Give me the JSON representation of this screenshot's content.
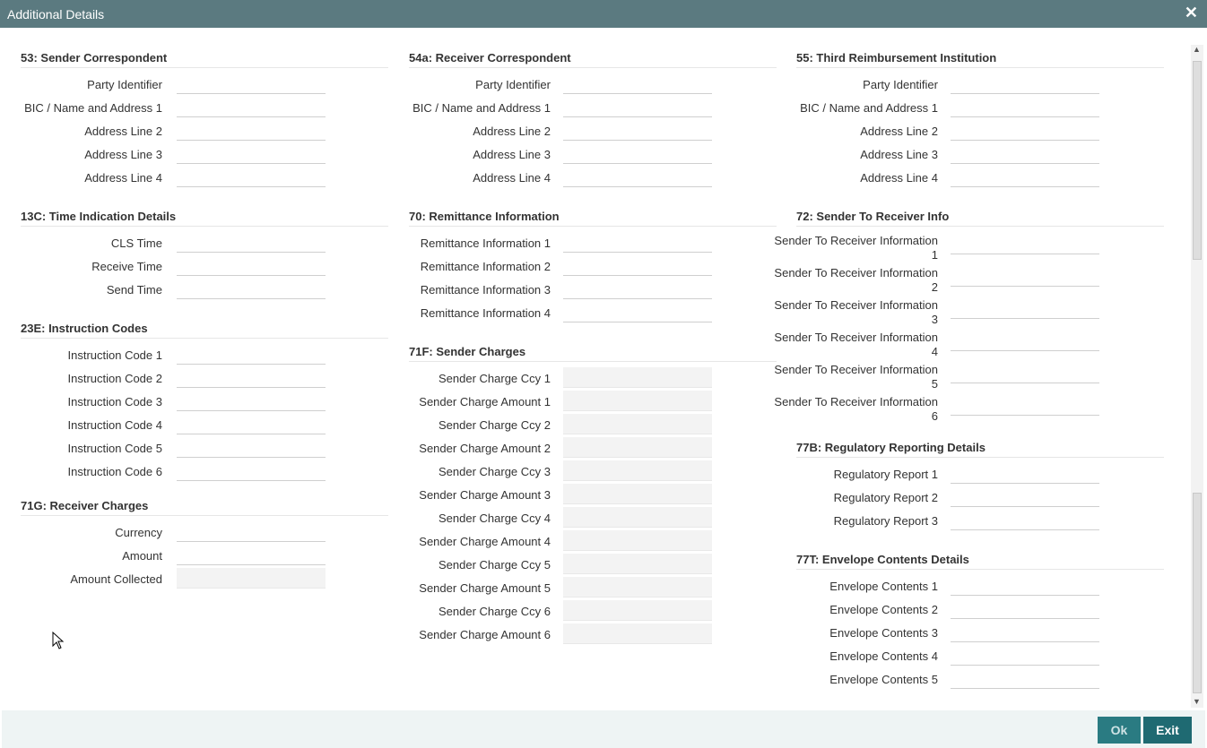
{
  "window": {
    "title": "Additional Details",
    "close_label": "✕"
  },
  "columns": [
    {
      "sections": [
        {
          "title": "53: Sender Correspondent",
          "fields": [
            {
              "label": "Party Identifier",
              "value": ""
            },
            {
              "label": "BIC / Name and Address 1",
              "value": ""
            },
            {
              "label": "Address Line 2",
              "value": ""
            },
            {
              "label": "Address Line 3",
              "value": ""
            },
            {
              "label": "Address Line 4",
              "value": ""
            }
          ]
        },
        {
          "title": "13C: Time Indication Details",
          "fields": [
            {
              "label": "CLS Time",
              "value": ""
            },
            {
              "label": "Receive Time",
              "value": ""
            },
            {
              "label": "Send Time",
              "value": ""
            }
          ]
        },
        {
          "title": "23E: Instruction Codes",
          "fields": [
            {
              "label": "Instruction Code 1",
              "value": ""
            },
            {
              "label": "Instruction Code 2",
              "value": ""
            },
            {
              "label": "Instruction Code 3",
              "value": ""
            },
            {
              "label": "Instruction Code 4",
              "value": ""
            },
            {
              "label": "Instruction Code 5",
              "value": ""
            },
            {
              "label": "Instruction Code 6",
              "value": ""
            }
          ]
        },
        {
          "title": "71G: Receiver Charges",
          "fields": [
            {
              "label": "Currency",
              "value": ""
            },
            {
              "label": "Amount",
              "value": ""
            },
            {
              "label": "Amount Collected",
              "value": "",
              "readonly": true
            }
          ]
        }
      ]
    },
    {
      "sections": [
        {
          "title": "54a: Receiver Correspondent",
          "fields": [
            {
              "label": "Party Identifier",
              "value": ""
            },
            {
              "label": "BIC / Name and Address 1",
              "value": ""
            },
            {
              "label": "Address Line 2",
              "value": ""
            },
            {
              "label": "Address Line 3",
              "value": ""
            },
            {
              "label": "Address Line 4",
              "value": ""
            }
          ]
        },
        {
          "title": "70: Remittance Information",
          "fields": [
            {
              "label": "Remittance Information 1",
              "value": ""
            },
            {
              "label": "Remittance Information 2",
              "value": ""
            },
            {
              "label": "Remittance Information 3",
              "value": ""
            },
            {
              "label": "Remittance Information 4",
              "value": ""
            }
          ]
        },
        {
          "title": "71F: Sender Charges",
          "fields": [
            {
              "label": "Sender Charge Ccy 1",
              "value": "",
              "readonly": true
            },
            {
              "label": "Sender Charge Amount 1",
              "value": "",
              "readonly": true
            },
            {
              "label": "Sender Charge Ccy 2",
              "value": "",
              "readonly": true
            },
            {
              "label": "Sender Charge Amount 2",
              "value": "",
              "readonly": true
            },
            {
              "label": "Sender Charge Ccy 3",
              "value": "",
              "readonly": true
            },
            {
              "label": "Sender Charge Amount 3",
              "value": "",
              "readonly": true
            },
            {
              "label": "Sender Charge Ccy 4",
              "value": "",
              "readonly": true
            },
            {
              "label": "Sender Charge Amount 4",
              "value": "",
              "readonly": true
            },
            {
              "label": "Sender Charge Ccy 5",
              "value": "",
              "readonly": true
            },
            {
              "label": "Sender Charge Amount 5",
              "value": "",
              "readonly": true
            },
            {
              "label": "Sender Charge Ccy 6",
              "value": "",
              "readonly": true
            },
            {
              "label": "Sender Charge Amount 6",
              "value": "",
              "readonly": true
            }
          ]
        }
      ]
    },
    {
      "sections": [
        {
          "title": "55: Third Reimbursement Institution",
          "fields": [
            {
              "label": "Party Identifier",
              "value": ""
            },
            {
              "label": "BIC / Name and Address 1",
              "value": ""
            },
            {
              "label": "Address Line 2",
              "value": ""
            },
            {
              "label": "Address Line 3",
              "value": ""
            },
            {
              "label": "Address Line 4",
              "value": ""
            }
          ]
        },
        {
          "title": "72: Sender To Receiver Info",
          "fields": [
            {
              "label": "Sender To Receiver Information 1",
              "value": "",
              "tall": true
            },
            {
              "label": "Sender To Receiver Information 2",
              "value": "",
              "tall": true
            },
            {
              "label": "Sender To Receiver Information 3",
              "value": "",
              "tall": true
            },
            {
              "label": "Sender To Receiver Information 4",
              "value": "",
              "tall": true
            },
            {
              "label": "Sender To Receiver Information 5",
              "value": "",
              "tall": true
            },
            {
              "label": "Sender To Receiver Information 6",
              "value": "",
              "tall": true
            }
          ]
        },
        {
          "title": "77B: Regulatory Reporting Details",
          "fields": [
            {
              "label": "Regulatory Report 1",
              "value": ""
            },
            {
              "label": "Regulatory Report 2",
              "value": ""
            },
            {
              "label": "Regulatory Report 3",
              "value": ""
            }
          ]
        },
        {
          "title": "77T: Envelope Contents Details",
          "fields": [
            {
              "label": "Envelope Contents 1",
              "value": ""
            },
            {
              "label": "Envelope Contents 2",
              "value": ""
            },
            {
              "label": "Envelope Contents 3",
              "value": ""
            },
            {
              "label": "Envelope Contents 4",
              "value": ""
            },
            {
              "label": "Envelope Contents 5",
              "value": ""
            }
          ]
        }
      ]
    }
  ],
  "footer": {
    "ok_label": "Ok",
    "exit_label": "Exit"
  }
}
